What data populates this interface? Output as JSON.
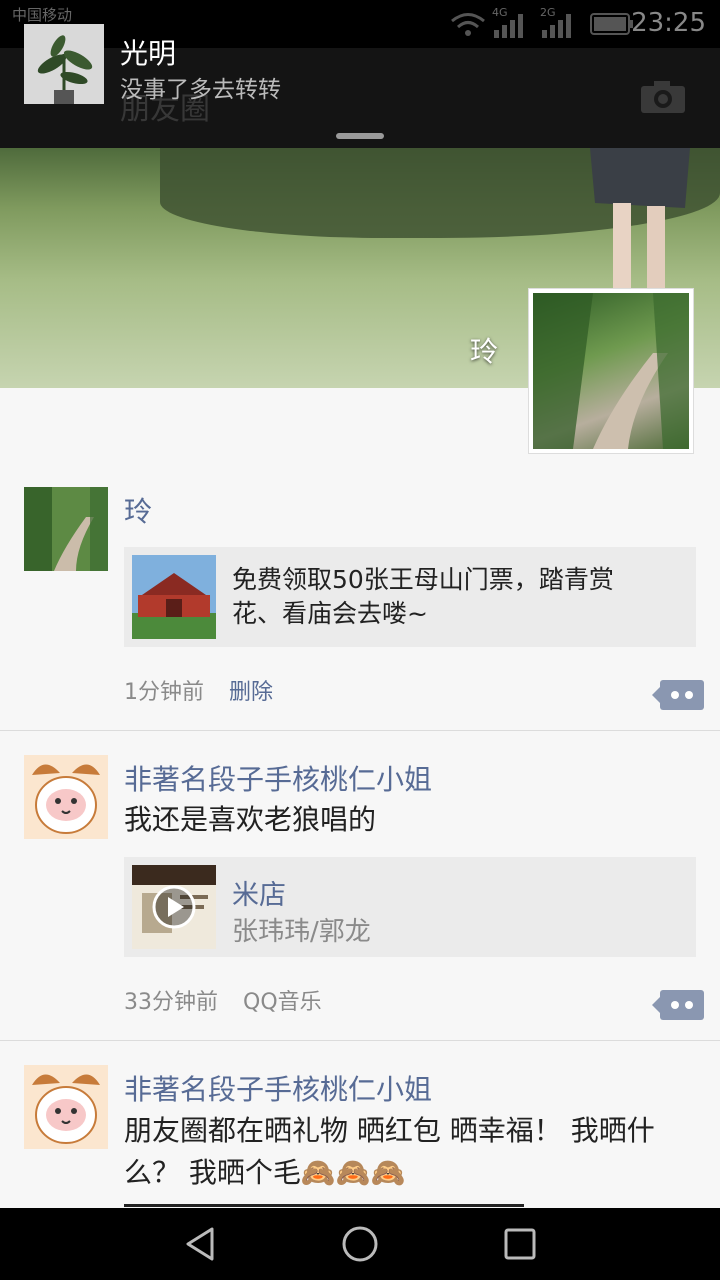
{
  "status_bar": {
    "carrier": "中国移动",
    "network_4g": "4G",
    "network_2g": "2G",
    "time": "23:25"
  },
  "notification": {
    "title": "光明",
    "message": "没事了多去转转"
  },
  "page": {
    "title": "朋友圈"
  },
  "cover": {
    "user_name": "玲"
  },
  "posts": [
    {
      "nickname": "玲",
      "text": "",
      "link_card": {
        "text_line1": "免费领取50张王母山门票，踏青赏",
        "text_line2": "花、看庙会去喽~"
      },
      "time": "1分钟前",
      "action": "删除"
    },
    {
      "nickname": "非著名段子手核桃仁小姐",
      "text": "我还是喜欢老狼唱的",
      "music_card": {
        "title": "米店",
        "artist": "张玮玮/郭龙"
      },
      "time": "33分钟前",
      "source": "QQ音乐"
    },
    {
      "nickname": "非著名段子手核桃仁小姐",
      "text_line1": "朋友圈都在晒礼物 晒红包 晒幸福！ 我晒什",
      "text_line2": "么？ 我晒个毛🙈🙈🙈"
    }
  ],
  "colors": {
    "link_blue": "#576b95",
    "meta_gray": "#8a8a8a",
    "card_bg": "#ebebeb"
  },
  "icons": [
    "wifi-icon",
    "signal-icon",
    "battery-icon",
    "camera-icon",
    "comment-more-icon",
    "back-nav-icon",
    "home-nav-icon",
    "recents-nav-icon",
    "play-icon"
  ]
}
